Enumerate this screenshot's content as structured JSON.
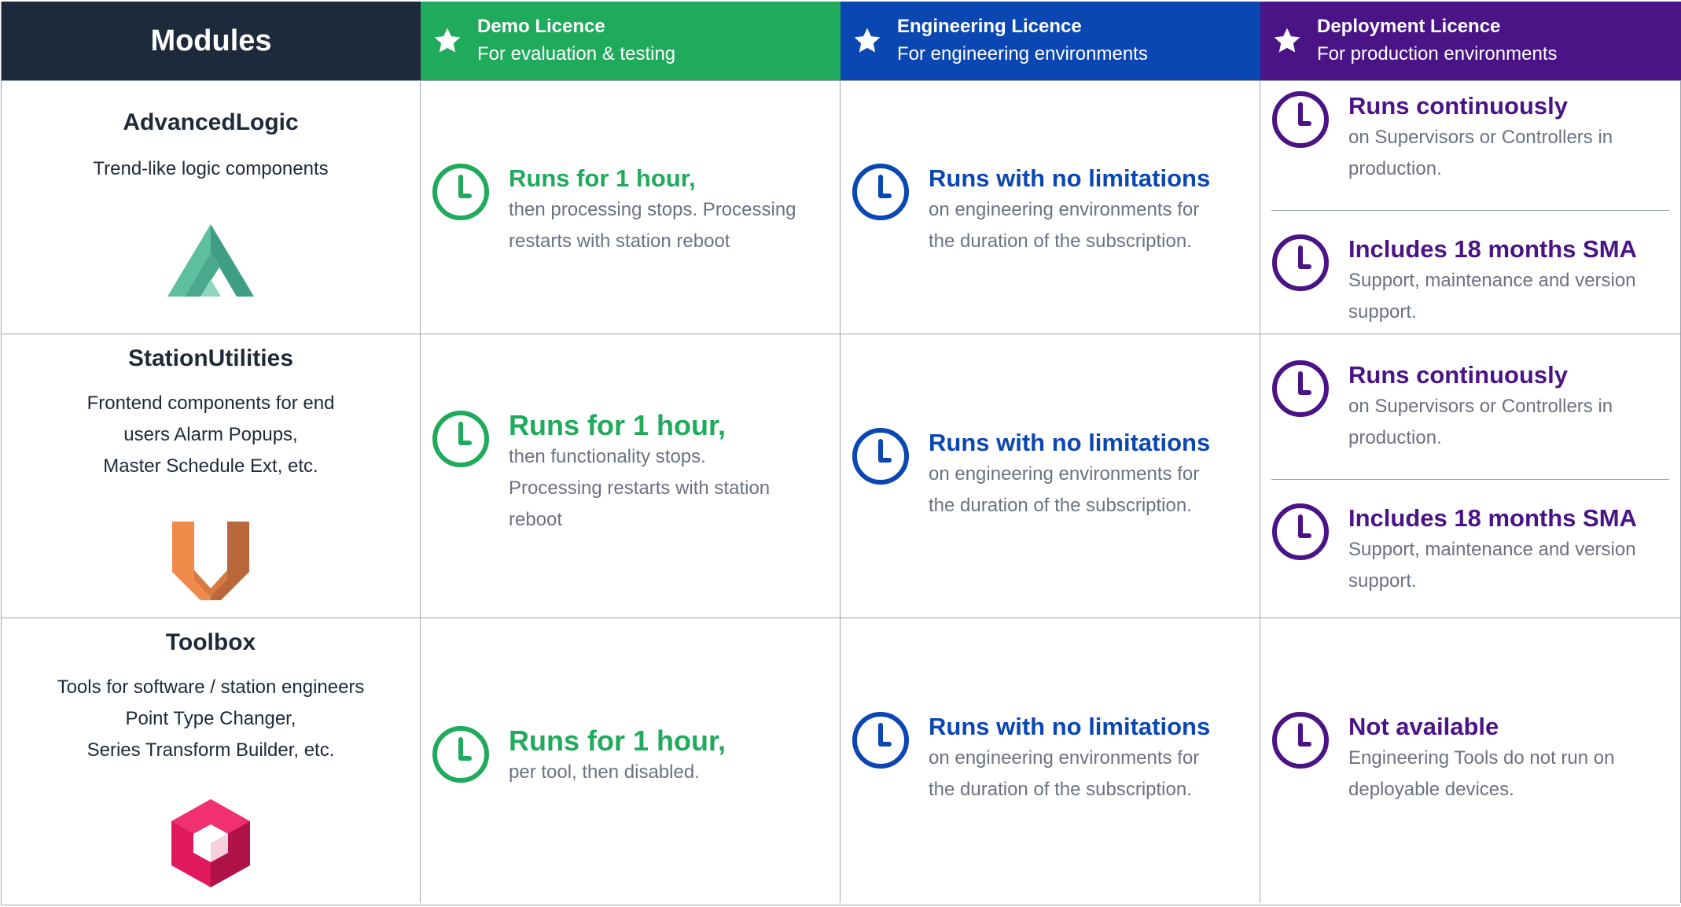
{
  "header": {
    "modules_label": "Modules",
    "demo": {
      "title": "Demo Licence",
      "subtitle": "For evaluation & testing",
      "color": "#1faa5c"
    },
    "engineering": {
      "title": "Engineering Licence",
      "subtitle": "For engineering environments",
      "color": "#0b47b2"
    },
    "deployment": {
      "title": "Deployment Licence",
      "subtitle": "For production environments",
      "color": "#4a1487"
    }
  },
  "rows": [
    {
      "module": {
        "name": "AdvancedLogic",
        "description": [
          "Trend-like logic components"
        ],
        "icon": "advancedlogic-logo-icon"
      },
      "demo": {
        "title": "Runs for 1 hour,",
        "text": [
          "then processing stops. Processing",
          "restarts with station reboot"
        ]
      },
      "engineering": {
        "title": "Runs with no limitations",
        "text": [
          "on engineering environments for",
          "the duration of the subscription."
        ]
      },
      "deployment": [
        {
          "title": "Runs continuously",
          "text": [
            "on Supervisors or Controllers in",
            "production."
          ]
        },
        {
          "title": "Includes 18 months SMA",
          "text": [
            "Support, maintenance and version",
            "support."
          ]
        }
      ]
    },
    {
      "module": {
        "name": "StationUtilities",
        "description": [
          "Frontend components for end",
          "users Alarm Popups,",
          "Master Schedule Ext, etc."
        ],
        "icon": "stationutilities-logo-icon"
      },
      "demo": {
        "title": "Runs for 1 hour,",
        "text": [
          "then functionality stops.",
          "Processing restarts with station",
          "reboot"
        ]
      },
      "engineering": {
        "title": "Runs with no limitations",
        "text": [
          "on engineering environments for",
          "the duration of the subscription."
        ]
      },
      "deployment": [
        {
          "title": "Runs continuously",
          "text": [
            "on Supervisors or Controllers in",
            "production."
          ]
        },
        {
          "title": "Includes 18 months SMA",
          "text": [
            "Support, maintenance and version",
            "support."
          ]
        }
      ]
    },
    {
      "module": {
        "name": "Toolbox",
        "description": [
          "Tools for software / station engineers",
          "Point Type Changer,",
          "Series Transform Builder, etc."
        ],
        "icon": "toolbox-logo-icon"
      },
      "demo": {
        "title": "Runs for 1 hour,",
        "text": [
          "per tool, then disabled."
        ]
      },
      "engineering": {
        "title": "Runs with no limitations",
        "text": [
          "on engineering environments for",
          "the duration of the subscription."
        ]
      },
      "deployment": [
        {
          "title": "Not available",
          "text": [
            "Engineering Tools do not run on",
            "deployable devices."
          ]
        }
      ]
    }
  ],
  "icons": {
    "header": "star-icon",
    "entry": "clock-icon"
  }
}
